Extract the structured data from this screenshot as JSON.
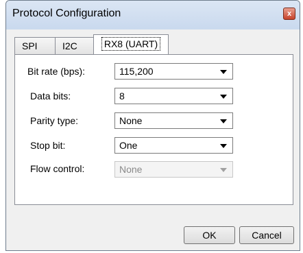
{
  "window": {
    "title": "Protocol Configuration",
    "close_glyph": "x",
    "close_icon": "close-icon"
  },
  "tabs": [
    {
      "label": "SPI",
      "selected": false
    },
    {
      "label": "I2C",
      "selected": false
    },
    {
      "label": "RX8 (UART)",
      "selected": true
    }
  ],
  "highlight_color": "#e21b2b",
  "fields": [
    {
      "label": "Bit rate (bps):",
      "value": "115,200",
      "enabled": true
    },
    {
      "label": "Data bits:",
      "value": "8",
      "enabled": true
    },
    {
      "label": "Parity type:",
      "value": "None",
      "enabled": true
    },
    {
      "label": "Stop bit:",
      "value": "One",
      "enabled": true
    },
    {
      "label": "Flow control:",
      "value": "None",
      "enabled": false
    }
  ],
  "buttons": {
    "ok": "OK",
    "cancel": "Cancel"
  }
}
